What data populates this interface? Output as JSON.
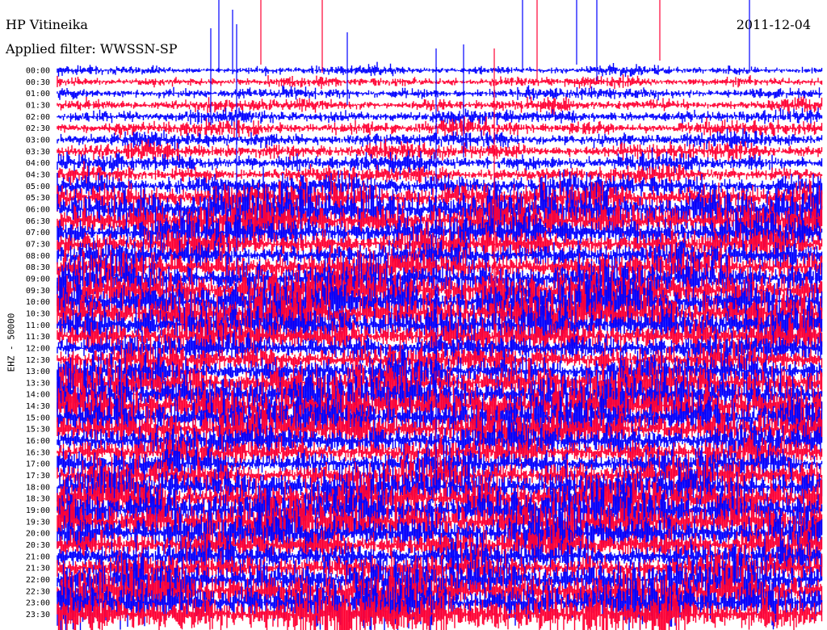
{
  "header": {
    "station": "HP Vitineika",
    "filter": "Applied filter: WWSSN-SP",
    "date": "2011-12-04"
  },
  "chart_data": {
    "type": "line",
    "subtype": "helicorder",
    "title": "HP Vitineika",
    "subtitle": "Applied filter: WWSSN-SP",
    "date": "2011-12-04",
    "ylabel": "EHZ - 50000",
    "row_labels": [
      "00:00",
      "00:30",
      "01:00",
      "01:30",
      "02:00",
      "02:30",
      "03:00",
      "03:30",
      "04:00",
      "04:30",
      "05:00",
      "05:30",
      "06:00",
      "06:30",
      "07:00",
      "07:30",
      "08:00",
      "08:30",
      "09:00",
      "09:30",
      "10:00",
      "10:30",
      "11:00",
      "11:30",
      "12:00",
      "12:30",
      "13:00",
      "13:30",
      "14:00",
      "14:30",
      "15:00",
      "15:30",
      "16:00",
      "16:30",
      "17:00",
      "17:30",
      "18:00",
      "18:30",
      "19:00",
      "19:30",
      "20:00",
      "20:30",
      "21:00",
      "21:30",
      "22:00",
      "22:30",
      "23:00",
      "23:30"
    ],
    "series_colors": [
      "#0000ff",
      "#ff0033"
    ],
    "background": "#ffffff",
    "grid": false,
    "legend": "none"
  }
}
